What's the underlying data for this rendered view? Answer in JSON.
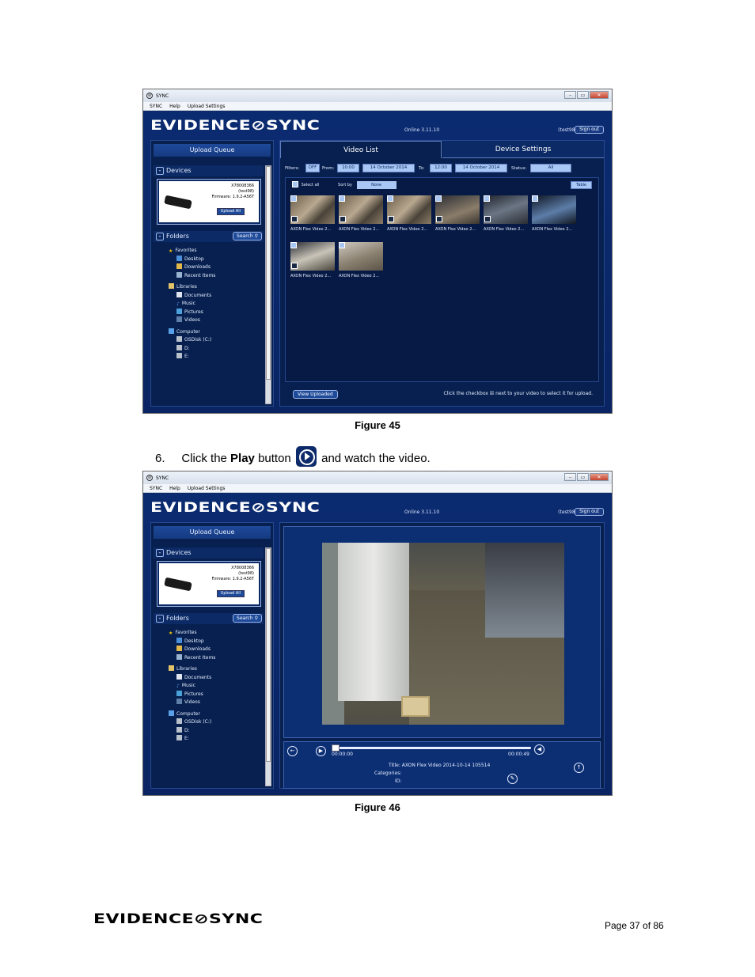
{
  "figure45": {
    "window_title": "SYNC",
    "menu": [
      "SYNC",
      "Help",
      "Upload Settings"
    ],
    "brand": "EVIDENCE⊘SYNC",
    "status": "Online 3.11.10",
    "user": "(test98)",
    "sign_out": "Sign out",
    "upload_queue": "Upload Queue",
    "devices_label": "Devices",
    "device": {
      "serial": "X78008366",
      "owner": "(test98)",
      "firmware": "Firmware: 1.9.2-A56T",
      "upload_all": "Upload All"
    },
    "folders_label": "Folders",
    "search": "Search",
    "tree": [
      {
        "label": "Favorites",
        "indent": 0
      },
      {
        "label": "Desktop",
        "indent": 1
      },
      {
        "label": "Downloads",
        "indent": 1
      },
      {
        "label": "Recent Items",
        "indent": 1
      },
      {
        "label": "Libraries",
        "indent": 0
      },
      {
        "label": "Documents",
        "indent": 1
      },
      {
        "label": "Music",
        "indent": 1
      },
      {
        "label": "Pictures",
        "indent": 1
      },
      {
        "label": "Videos",
        "indent": 1
      },
      {
        "label": "Computer",
        "indent": 0
      },
      {
        "label": "OSDisk (C:)",
        "indent": 1
      },
      {
        "label": "D:",
        "indent": 1
      },
      {
        "label": "E:",
        "indent": 1
      }
    ],
    "tabs": [
      "Video List",
      "Device Settings"
    ],
    "filters": {
      "filters_label": "Filters:",
      "toggle": "OFF",
      "from_label": "From:",
      "from_time": "10:00",
      "from_date": "14 October 2014",
      "to_label": "To:",
      "to_time": "12:00",
      "to_date": "14 October 2014",
      "status_label": "Status:",
      "status_value": "All"
    },
    "select_all": "Select all",
    "sort_by_label": "Sort by",
    "sort_by_value": "None",
    "table_button": "Table",
    "videos": [
      "AXON Flex Video 2...",
      "AXON Flex Video 2...",
      "AXON Flex Video 2...",
      "AXON Flex Video 2...",
      "AXON Flex Video 2...",
      "AXON Flex Video 2...",
      "AXON Flex Video 2...",
      "AXON Flex Video 2..."
    ],
    "view_uploaded": "View Uploaded",
    "hint": "Click the checkbox ☒ next to your video to select it for upload.",
    "caption": "Figure 45"
  },
  "step": {
    "number": "6.",
    "pre": "Click the ",
    "bold": "Play",
    "mid": " button ",
    "post": " and watch the video."
  },
  "figure46": {
    "time_start": "00:00:00",
    "time_end": "00:00:49",
    "title_line": "Title: AXON Flex Video 2014-10-14 105514",
    "categories": "Categories:",
    "id": "ID:",
    "caption": "Figure 46"
  },
  "footer": {
    "brand": "EVIDENCE⊘SYNC",
    "page": "Page 37 of 86"
  }
}
